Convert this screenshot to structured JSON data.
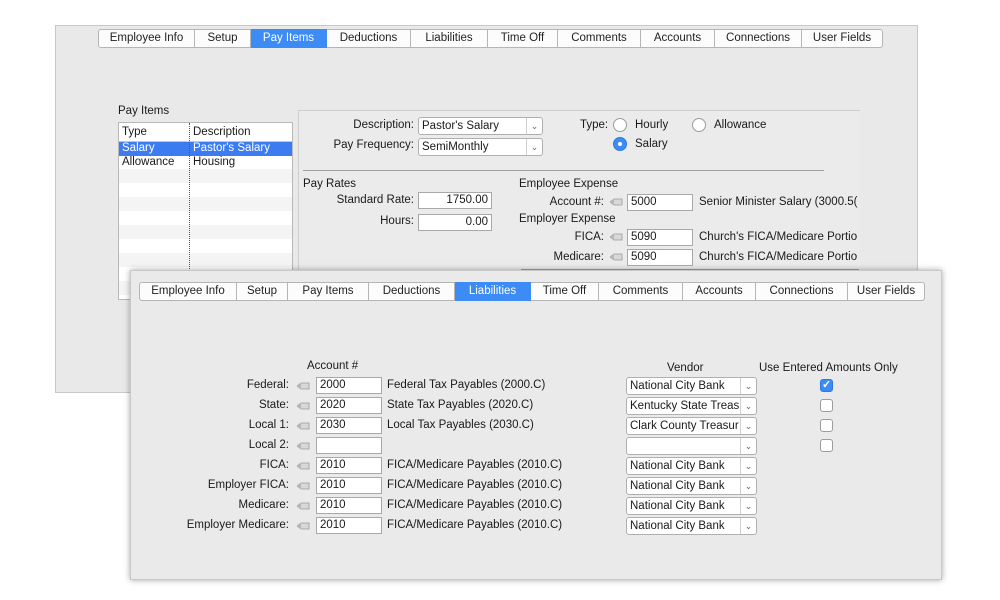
{
  "back_window": {
    "tabs": [
      {
        "label": "Employee Info",
        "active": false
      },
      {
        "label": "Setup",
        "active": false
      },
      {
        "label": "Pay Items",
        "active": true
      },
      {
        "label": "Deductions",
        "active": false
      },
      {
        "label": "Liabilities",
        "active": false
      },
      {
        "label": "Time Off",
        "active": false
      },
      {
        "label": "Comments",
        "active": false
      },
      {
        "label": "Accounts",
        "active": false
      },
      {
        "label": "Connections",
        "active": false
      },
      {
        "label": "User Fields",
        "active": false
      }
    ],
    "pay_items_title": "Pay Items",
    "list_headers": {
      "type": "Type",
      "description": "Description"
    },
    "list_rows": [
      {
        "type": "Salary",
        "description": "Pastor's Salary",
        "selected": true
      },
      {
        "type": "Allowance",
        "description": "Housing",
        "selected": false
      }
    ],
    "description_label": "Description:",
    "description_value": "Pastor's Salary",
    "pay_frequency_label": "Pay Frequency:",
    "pay_frequency_value": "SemiMonthly",
    "type_label": "Type:",
    "type_options": {
      "hourly": "Hourly",
      "allowance": "Allowance",
      "salary": "Salary",
      "selected": "Salary"
    },
    "pay_rates_title": "Pay Rates",
    "standard_rate_label": "Standard Rate:",
    "standard_rate_value": "1750.00",
    "hours_label": "Hours:",
    "hours_value": "0.00",
    "employee_expense_title": "Employee Expense",
    "account_label": "Account #:",
    "account_value": "5000",
    "account_desc": "Senior Minister Salary (3000.5(",
    "employer_expense_title": "Employer Expense",
    "fica_label": "FICA:",
    "fica_value": "5090",
    "fica_desc": "Church's FICA/Medicare Portio",
    "medicare_label": "Medicare:",
    "medicare_value": "5090",
    "medicare_desc": "Church's FICA/Medicare Portio"
  },
  "front_window": {
    "tabs": [
      {
        "label": "Employee Info",
        "active": false
      },
      {
        "label": "Setup",
        "active": false
      },
      {
        "label": "Pay Items",
        "active": false
      },
      {
        "label": "Deductions",
        "active": false
      },
      {
        "label": "Liabilities",
        "active": true
      },
      {
        "label": "Time Off",
        "active": false
      },
      {
        "label": "Comments",
        "active": false
      },
      {
        "label": "Accounts",
        "active": false
      },
      {
        "label": "Connections",
        "active": false
      },
      {
        "label": "User Fields",
        "active": false
      }
    ],
    "account_header": "Account #",
    "vendor_header": "Vendor",
    "use_entered_header": "Use Entered Amounts Only",
    "rows": [
      {
        "label": "Federal:",
        "account": "2000",
        "desc": "Federal Tax Payables (2000.C)",
        "vendor": "National City Bank",
        "checkbox": true,
        "checked": true
      },
      {
        "label": "State:",
        "account": "2020",
        "desc": "State Tax Payables (2020.C)",
        "vendor": "Kentucky State Treas",
        "checkbox": true,
        "checked": false
      },
      {
        "label": "Local 1:",
        "account": "2030",
        "desc": "Local Tax Payables (2030.C)",
        "vendor": "Clark County Treasur",
        "checkbox": true,
        "checked": false
      },
      {
        "label": "Local 2:",
        "account": "",
        "desc": "",
        "vendor": "",
        "checkbox": true,
        "checked": false
      },
      {
        "label": "FICA:",
        "account": "2010",
        "desc": "FICA/Medicare Payables (2010.C)",
        "vendor": "National City Bank",
        "checkbox": false,
        "checked": false
      },
      {
        "label": "Employer FICA:",
        "account": "2010",
        "desc": "FICA/Medicare Payables (2010.C)",
        "vendor": "National City Bank",
        "checkbox": false,
        "checked": false
      },
      {
        "label": "Medicare:",
        "account": "2010",
        "desc": "FICA/Medicare Payables (2010.C)",
        "vendor": "National City Bank",
        "checkbox": false,
        "checked": false
      },
      {
        "label": "Employer Medicare:",
        "account": "2010",
        "desc": "FICA/Medicare Payables (2010.C)",
        "vendor": "National City Bank",
        "checkbox": false,
        "checked": false
      }
    ]
  },
  "icons": {
    "lookup": "pencil-lookup-icon",
    "dropdown": "chevron-down-icon"
  },
  "colors": {
    "accent": "#3d8bf5",
    "panel": "#e9e9e9"
  }
}
